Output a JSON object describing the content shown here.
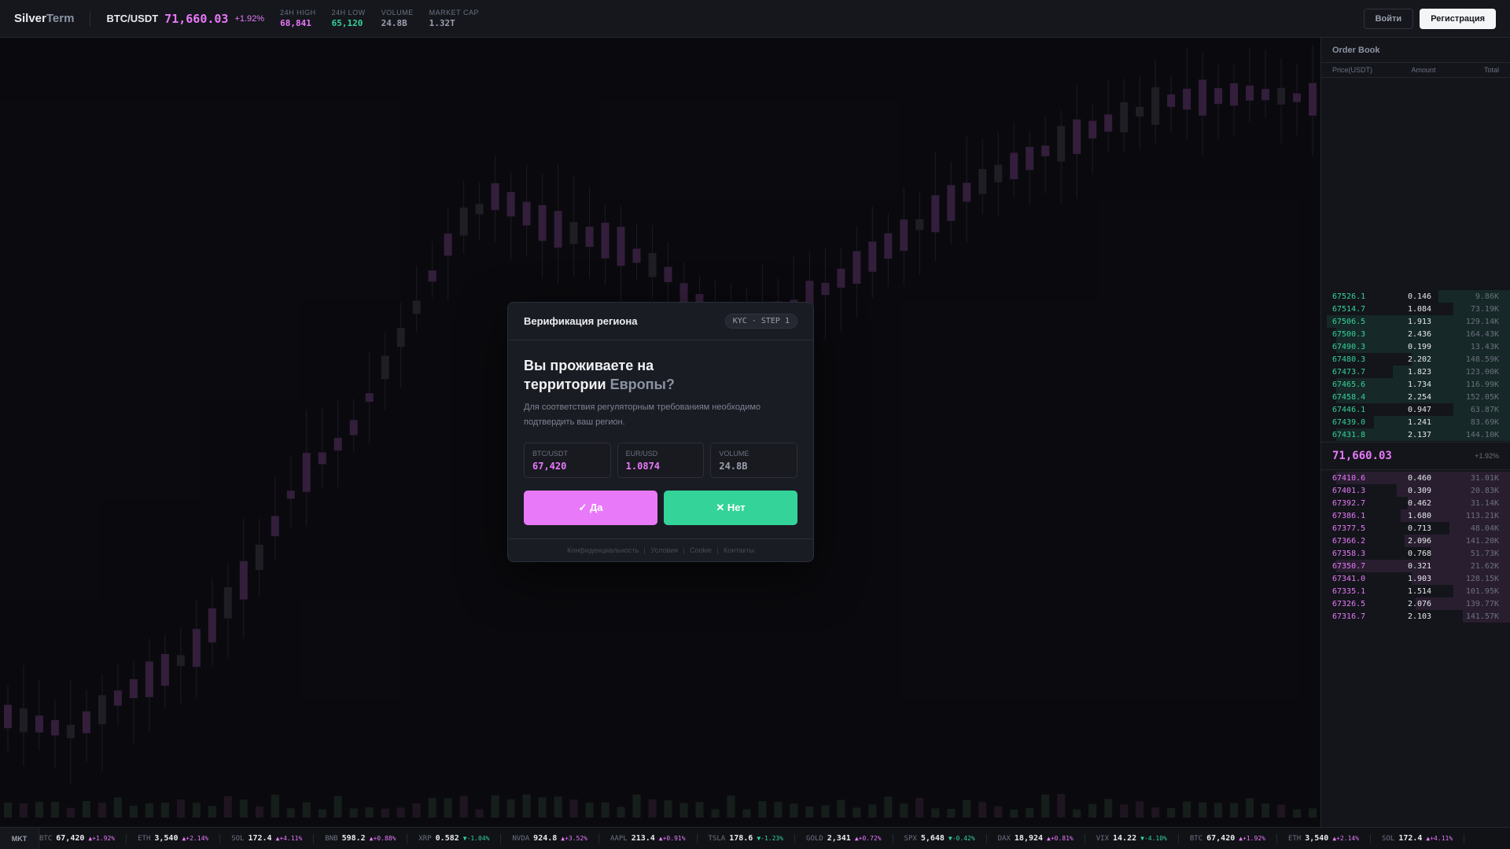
{
  "header": {
    "logo_a": "Silver",
    "logo_b": "Term",
    "pair": "BTC/USDT",
    "price": "71,660.03",
    "change": "+1.92%",
    "stats": [
      {
        "label": "24H HIGH",
        "value": "68,841",
        "color": "#e879f9"
      },
      {
        "label": "24H LOW",
        "value": "65,120",
        "color": "#34d399"
      },
      {
        "label": "VOLUME",
        "value": "24.8B",
        "color": "#9aa0ad"
      },
      {
        "label": "MARKET CAP",
        "value": "1.32T",
        "color": "#9aa0ad"
      }
    ],
    "login_label": "Войти",
    "register_label": "Регистрация"
  },
  "orderbook": {
    "title": "Order Book",
    "col_price": "Price(USDT)",
    "col_amount": "Amount",
    "col_total": "Total",
    "asks": [
      {
        "price": "67526.1",
        "amount": "0.146",
        "total": "9.86K",
        "depth": 0.38
      },
      {
        "price": "67514.7",
        "amount": "1.084",
        "total": "73.19K",
        "depth": 0.3
      },
      {
        "price": "67506.5",
        "amount": "1.913",
        "total": "129.14K",
        "depth": 0.97
      },
      {
        "price": "67500.3",
        "amount": "2.436",
        "total": "164.43K",
        "depth": 0.92
      },
      {
        "price": "67490.3",
        "amount": "0.199",
        "total": "13.43K",
        "depth": 0.92
      },
      {
        "price": "67480.3",
        "amount": "2.202",
        "total": "148.59K",
        "depth": 0.52
      },
      {
        "price": "67473.7",
        "amount": "1.823",
        "total": "123.00K",
        "depth": 0.62
      },
      {
        "price": "67465.6",
        "amount": "1.734",
        "total": "116.99K",
        "depth": 0.92
      },
      {
        "price": "67458.4",
        "amount": "2.254",
        "total": "152.05K",
        "depth": 0.92
      },
      {
        "price": "67446.1",
        "amount": "0.947",
        "total": "63.87K",
        "depth": 0.3
      },
      {
        "price": "67439.0",
        "amount": "1.241",
        "total": "83.69K",
        "depth": 0.72
      },
      {
        "price": "67431.8",
        "amount": "2.137",
        "total": "144.10K",
        "depth": 0.92
      }
    ],
    "mid_price": "71,660.03",
    "mid_change": "+1.92%",
    "bids": [
      {
        "price": "67410.6",
        "amount": "0.460",
        "total": "31.01K",
        "depth": 0.92
      },
      {
        "price": "67401.3",
        "amount": "0.309",
        "total": "20.83K",
        "depth": 0.6
      },
      {
        "price": "67392.7",
        "amount": "0.462",
        "total": "31.14K",
        "depth": 0.54
      },
      {
        "price": "67386.1",
        "amount": "1.680",
        "total": "113.21K",
        "depth": 0.58
      },
      {
        "price": "67377.5",
        "amount": "0.713",
        "total": "48.04K",
        "depth": 0.32
      },
      {
        "price": "67366.2",
        "amount": "2.096",
        "total": "141.20K",
        "depth": 0.56
      },
      {
        "price": "67358.3",
        "amount": "0.768",
        "total": "51.73K",
        "depth": 0.42
      },
      {
        "price": "67350.7",
        "amount": "0.321",
        "total": "21.62K",
        "depth": 0.92
      },
      {
        "price": "67341.0",
        "amount": "1.903",
        "total": "128.15K",
        "depth": 0.52
      },
      {
        "price": "67335.1",
        "amount": "1.514",
        "total": "101.95K",
        "depth": 0.3
      },
      {
        "price": "67326.5",
        "amount": "2.076",
        "total": "139.77K",
        "depth": 0.5
      },
      {
        "price": "67316.7",
        "amount": "2.103",
        "total": "141.57K",
        "depth": 0.25
      }
    ]
  },
  "ticker": {
    "label": "MKT",
    "items": [
      {
        "sym": "BTC",
        "val": "67,420",
        "chg": "▲+1.92%",
        "up": true
      },
      {
        "sym": "ETH",
        "val": "3,540",
        "chg": "▲+2.14%",
        "up": true
      },
      {
        "sym": "SOL",
        "val": "172.4",
        "chg": "▲+4.11%",
        "up": true
      },
      {
        "sym": "BNB",
        "val": "598.2",
        "chg": "▲+0.88%",
        "up": true
      },
      {
        "sym": "XRP",
        "val": "0.582",
        "chg": "▼-1.04%",
        "up": false
      },
      {
        "sym": "NVDA",
        "val": "924.8",
        "chg": "▲+3.52%",
        "up": true
      },
      {
        "sym": "AAPL",
        "val": "213.4",
        "chg": "▲+0.91%",
        "up": true
      },
      {
        "sym": "TSLA",
        "val": "178.6",
        "chg": "▼-1.23%",
        "up": false
      },
      {
        "sym": "GOLD",
        "val": "2,341",
        "chg": "▲+0.72%",
        "up": true
      },
      {
        "sym": "SPX",
        "val": "5,648",
        "chg": "▼-0.42%",
        "up": false
      },
      {
        "sym": "DAX",
        "val": "18,924",
        "chg": "▲+0.81%",
        "up": true
      },
      {
        "sym": "VIX",
        "val": "14.22",
        "chg": "▼-4.10%",
        "up": false
      },
      {
        "sym": "BTC",
        "val": "67,420",
        "chg": "▲+1.92%",
        "up": true
      },
      {
        "sym": "ETH",
        "val": "3,540",
        "chg": "▲+2.14%",
        "up": true
      },
      {
        "sym": "SOL",
        "val": "172.4",
        "chg": "▲+4.11%",
        "up": true
      }
    ]
  },
  "modal": {
    "title": "Верификация региона",
    "badge": "KYC · STEP 1",
    "question_a": "Вы проживаете на",
    "question_b": "территории",
    "question_hl": "Европы?",
    "description": "Для соответствия регуляторным требованиям необходимо подтвердить ваш регион.",
    "stats": [
      {
        "label": "BTC/USDT",
        "value": "67,420",
        "color": "#e879f9"
      },
      {
        "label": "EUR/USD",
        "value": "1.0874",
        "color": "#e879f9"
      },
      {
        "label": "VOLUME",
        "value": "24.8B",
        "color": "#9aa0ad"
      }
    ],
    "yes_label": "✓ Да",
    "no_label": "✕ Нет",
    "footer_links": [
      "Конфиденциальность",
      "Условия",
      "Cookie",
      "Контакты"
    ]
  },
  "colors": {
    "accent_pink": "#e879f9",
    "accent_green": "#34d399"
  }
}
